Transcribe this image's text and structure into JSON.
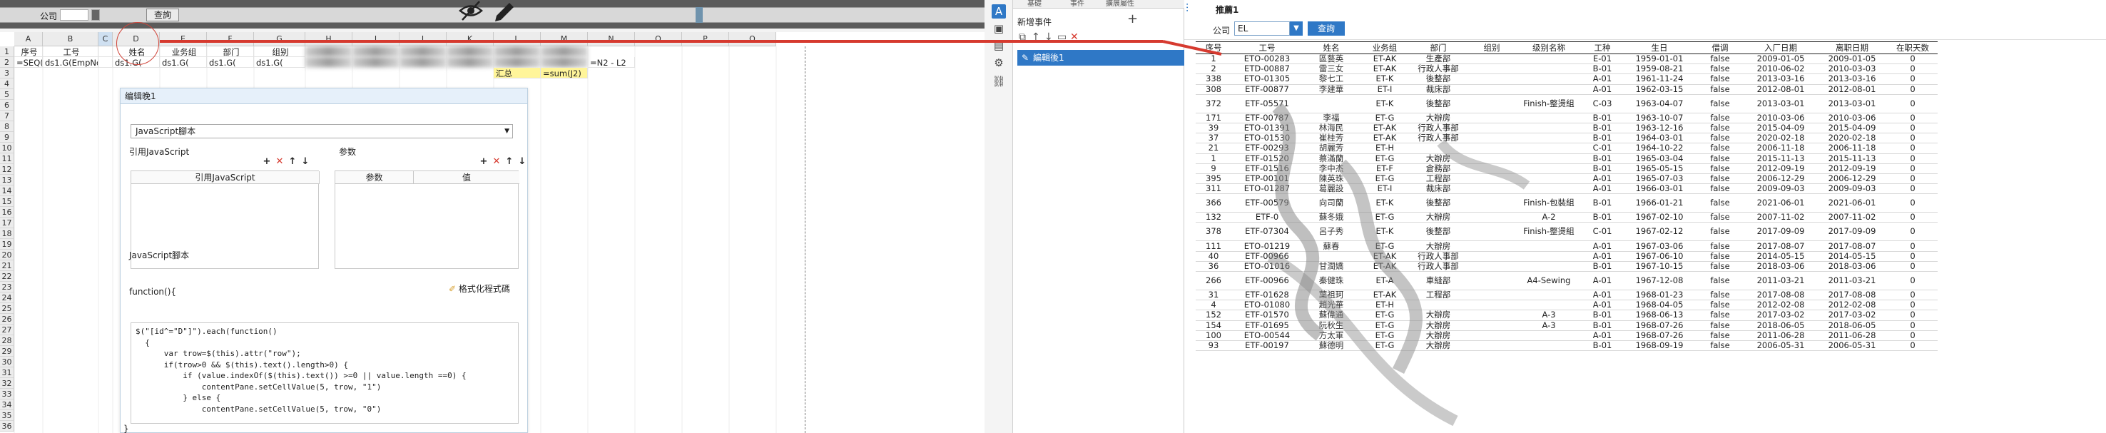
{
  "designer": {
    "param_company_label": "公司",
    "query_label": "查詢",
    "columns": [
      "A",
      "B",
      "C",
      "D",
      "E",
      "F",
      "G",
      "H",
      "I",
      "J",
      "K",
      "L",
      "M",
      "N",
      "O",
      "P",
      "Q"
    ],
    "rows": [
      "1",
      "2",
      "3",
      "4",
      "5",
      "6",
      "7",
      "8",
      "9",
      "10",
      "11",
      "12",
      "13",
      "14",
      "15",
      "16",
      "17",
      "18",
      "19",
      "20",
      "21",
      "22",
      "23",
      "24",
      "25",
      "26",
      "27",
      "28",
      "29",
      "30",
      "31",
      "32",
      "33",
      "34",
      "35",
      "36"
    ],
    "header_cells": [
      "序号",
      "工号",
      "",
      "姓名",
      "业务组",
      "部门",
      "组别"
    ],
    "formula_cells": [
      "=SEQ()",
      "ds1.G(EmpNo)",
      "",
      "ds1.G(",
      "ds1.G(",
      "ds1.G(",
      "ds1.G("
    ],
    "summary_label": "汇总",
    "summary_formula": "=sum(J2)",
    "q2_formula": "=N2 - L2"
  },
  "dialog": {
    "title": "编辑晚1",
    "type_select": "JavaScript腳本",
    "ref_js_label": "引用JavaScript",
    "params_label": "参数",
    "ref_js_col": "引用JavaScript",
    "param_col": "参数",
    "value_col": "值",
    "script_label": "JavaScript腳本",
    "func_open": "function(){",
    "format_label": "格式化程式碼",
    "code_lines": [
      "$(\"[id^=\"D\"]\").each(function()",
      "  {",
      "      var trow=$(this).attr(\"row\");",
      "      if(trow>0 && $(this).text().length>0) {",
      "          if (value.indexOf($(this).text()) >=0 || value.length ==0) {",
      "              contentPane.setCellValue(5, trow, \"1\")",
      "          } else {",
      "              contentPane.setCellValue(5, trow, \"0\")"
    ],
    "func_close": "}"
  },
  "events": {
    "tabs": [
      "基礎",
      "事件",
      "擴展屬性"
    ],
    "new_event_label": "新增事件",
    "add_icon": "+",
    "item_label": "編輯後1"
  },
  "preview": {
    "title": "推薦1",
    "company_label": "公司",
    "company_value": "EL",
    "query_label": "查詢",
    "headers": [
      "序号",
      "工号",
      "姓名",
      "业务组",
      "部门",
      "组别",
      "级别名称",
      "工种",
      "生日",
      "借调",
      "入厂日期",
      "离职日期",
      "在职天数"
    ],
    "rows": [
      [
        "1",
        "ETO-00283",
        "區藝英",
        "ET-AK",
        "生產部",
        "",
        "",
        "E-01",
        "1959-01-01",
        "false",
        "2009-01-05",
        "2009-01-05",
        "0"
      ],
      [
        "2",
        "ETD-00887",
        "雷三女",
        "ET-AK",
        "行政人事部",
        "",
        "",
        "B-01",
        "1959-08-21",
        "false",
        "2010-06-02",
        "2010-03-03",
        "0"
      ],
      [
        "338",
        "ETO-01305",
        "黎七工",
        "ET-K",
        "後整部",
        "",
        "",
        "A-01",
        "1961-11-24",
        "false",
        "2013-03-16",
        "2013-03-16",
        "0"
      ],
      [
        "308",
        "ETF-00877",
        "李建華",
        "ET-I",
        "裁床部",
        "",
        "",
        "A-01",
        "1962-03-15",
        "false",
        "2012-08-01",
        "2012-08-01",
        "0"
      ],
      [
        "372",
        "ETF-05571",
        "",
        "ET-K",
        "後整部",
        "",
        "Finish-整燙組",
        "C-03",
        "1963-04-07",
        "false",
        "2013-03-01",
        "2013-03-01",
        "0"
      ],
      [
        "171",
        "ETF-00787",
        "李福",
        "ET-G",
        "大辦房",
        "",
        "",
        "B-01",
        "1963-10-07",
        "false",
        "2010-03-06",
        "2010-03-06",
        "0"
      ],
      [
        "39",
        "ETO-01391",
        "林海民",
        "ET-AK",
        "行政人事部",
        "",
        "",
        "B-01",
        "1963-12-16",
        "false",
        "2015-04-09",
        "2015-04-09",
        "0"
      ],
      [
        "37",
        "ETO-01530",
        "崔桂芳",
        "ET-AK",
        "行政人事部",
        "",
        "",
        "B-01",
        "1964-03-01",
        "false",
        "2020-02-18",
        "2020-02-18",
        "0"
      ],
      [
        "21",
        "ETF-00293",
        "胡麗芳",
        "ET-H",
        "",
        "",
        "",
        "C-01",
        "1964-10-22",
        "false",
        "2006-11-18",
        "2006-11-18",
        "0"
      ],
      [
        "1",
        "ETF-01520",
        "蔡滿蘭",
        "ET-G",
        "大辦房",
        "",
        "",
        "B-01",
        "1965-03-04",
        "false",
        "2015-11-13",
        "2015-11-13",
        "0"
      ],
      [
        "9",
        "ETF-01516",
        "李中杰",
        "ET-F",
        "倉務部",
        "",
        "",
        "B-01",
        "1965-05-15",
        "false",
        "2012-09-19",
        "2012-09-19",
        "0"
      ],
      [
        "395",
        "ETP-00101",
        "陳英珠",
        "ET-G",
        "工程部",
        "",
        "",
        "A-01",
        "1965-07-03",
        "false",
        "2006-12-29",
        "2006-12-29",
        "0"
      ],
      [
        "311",
        "ETO-01287",
        "葛麗設",
        "ET-I",
        "裁床部",
        "",
        "",
        "A-01",
        "1966-03-01",
        "false",
        "2009-09-03",
        "2009-09-03",
        "0"
      ],
      [
        "366",
        "ETF-00579",
        "向司蘭",
        "ET-K",
        "後整部",
        "",
        "Finish-包裝組",
        "B-01",
        "1966-01-21",
        "false",
        "2021-06-01",
        "2021-06-01",
        "0"
      ],
      [
        "132",
        "ETF-0",
        "蘇冬娥",
        "ET-G",
        "大辦房",
        "",
        "A-2",
        "B-01",
        "1967-02-10",
        "false",
        "2007-11-02",
        "2007-11-02",
        "0"
      ],
      [
        "378",
        "ETF-07304",
        "呂子秀",
        "ET-K",
        "後整部",
        "",
        "Finish-整燙組",
        "C-01",
        "1967-02-12",
        "false",
        "2017-09-09",
        "2017-09-09",
        "0"
      ],
      [
        "111",
        "ETO-01219",
        "蘇春",
        "ET-G",
        "大辦房",
        "",
        "",
        "A-01",
        "1967-03-06",
        "false",
        "2017-08-07",
        "2017-08-07",
        "0"
      ],
      [
        "40",
        "ETF-00966",
        "",
        "ET-AK",
        "行政人事部",
        "",
        "",
        "A-01",
        "1967-06-10",
        "false",
        "2014-05-15",
        "2014-05-15",
        "0"
      ],
      [
        "36",
        "ETO-01016",
        "甘潤嬌",
        "ET-AK",
        "行政人事部",
        "",
        "",
        "B-01",
        "1967-10-15",
        "false",
        "2018-03-06",
        "2018-03-06",
        "0"
      ],
      [
        "266",
        "ETF-00966",
        "秦健珠",
        "ET-A",
        "車縫部",
        "",
        "A4-Sewing",
        "A-01",
        "1967-12-08",
        "false",
        "2011-03-21",
        "2011-03-21",
        "0"
      ],
      [
        "31",
        "ETF-01628",
        "葉祖珂",
        "ET-AK",
        "工程部",
        "",
        "",
        "A-01",
        "1968-01-23",
        "false",
        "2017-08-08",
        "2017-08-08",
        "0"
      ],
      [
        "4",
        "ETO-01080",
        "趙光華",
        "ET-H",
        "",
        "",
        "",
        "A-01",
        "1968-04-05",
        "false",
        "2012-02-08",
        "2012-02-08",
        "0"
      ],
      [
        "152",
        "ETF-01570",
        "蘇偉通",
        "ET-G",
        "大辦房",
        "",
        "A-3",
        "B-01",
        "1968-06-13",
        "false",
        "2017-03-02",
        "2017-03-02",
        "0"
      ],
      [
        "154",
        "ETF-01695",
        "阮秋生",
        "ET-G",
        "大辦房",
        "",
        "A-3",
        "B-01",
        "1968-07-26",
        "false",
        "2018-06-05",
        "2018-06-05",
        "0"
      ],
      [
        "100",
        "ETO-00544",
        "方太軍",
        "ET-G",
        "大辦房",
        "",
        "",
        "A-01",
        "1968-07-26",
        "false",
        "2011-06-28",
        "2011-06-28",
        "0"
      ],
      [
        "93",
        "ETF-00197",
        "蘇德明",
        "ET-G",
        "大辦房",
        "",
        "",
        "B-01",
        "1968-09-19",
        "false",
        "2006-05-31",
        "2006-05-31",
        "0"
      ]
    ]
  },
  "colors": {
    "accent": "#2f78c6",
    "arrow": "#d63a2f",
    "summary_fill": "#fff59a"
  }
}
